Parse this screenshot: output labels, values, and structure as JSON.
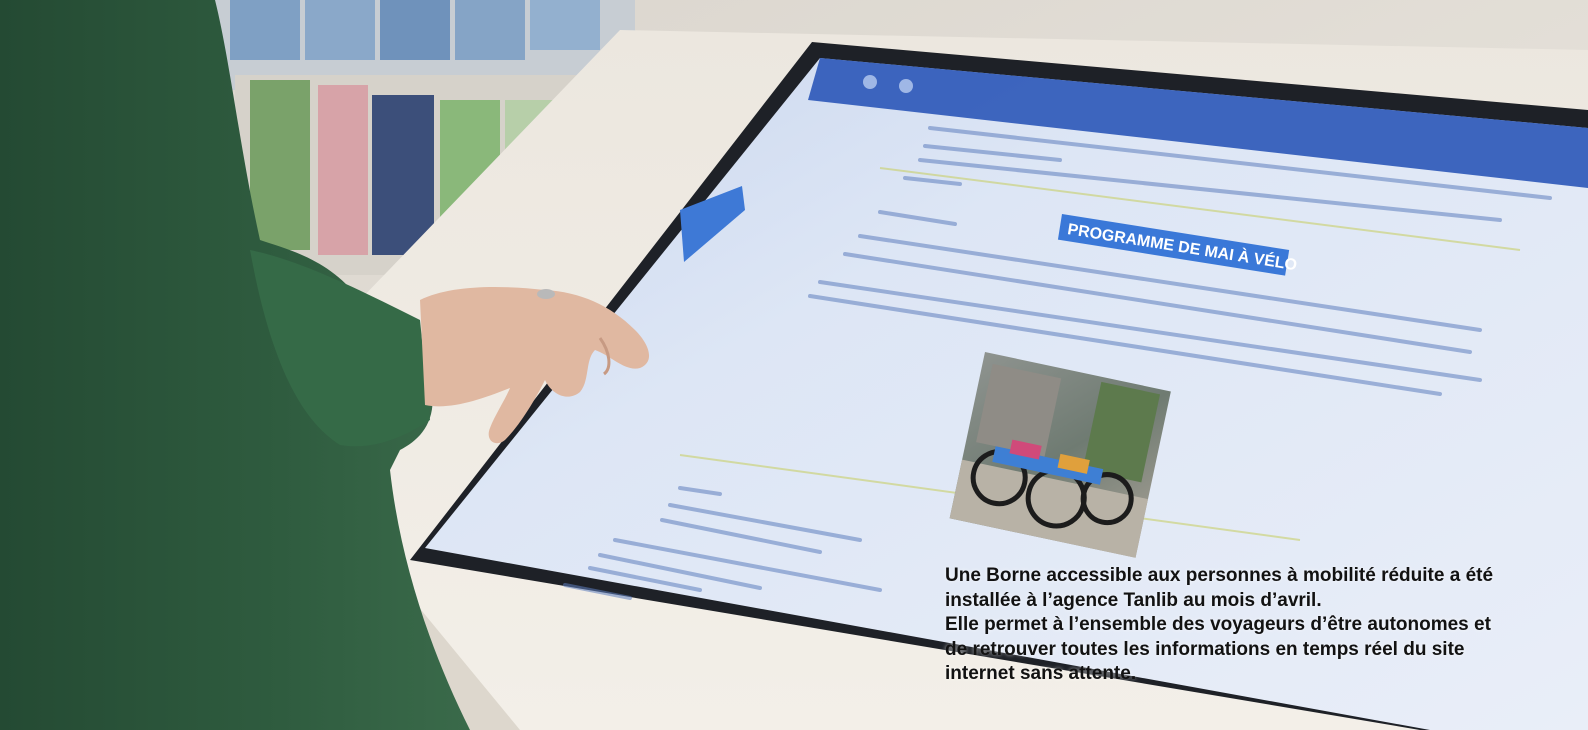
{
  "screen": {
    "program_title": "PROGRAMME DE MAI À VÉLO"
  },
  "caption": {
    "paragraph_1": "Une Borne accessible aux personnes à mobilité réduite a été installée à l’agence Tanlib au mois d’avril.",
    "paragraph_2": "Elle permet à l’ensemble des voyageurs d’être autonomes et de retrouver toutes les informations en temps réel du site internet sans attente."
  },
  "colors": {
    "sweater": "#2f5c3f",
    "kiosk_body": "#ebe6df",
    "screen_bg": "#dfe8f6",
    "screen_header": "#2b56b8",
    "title_highlight": "#3a78d8",
    "caption_text": "#121212"
  }
}
